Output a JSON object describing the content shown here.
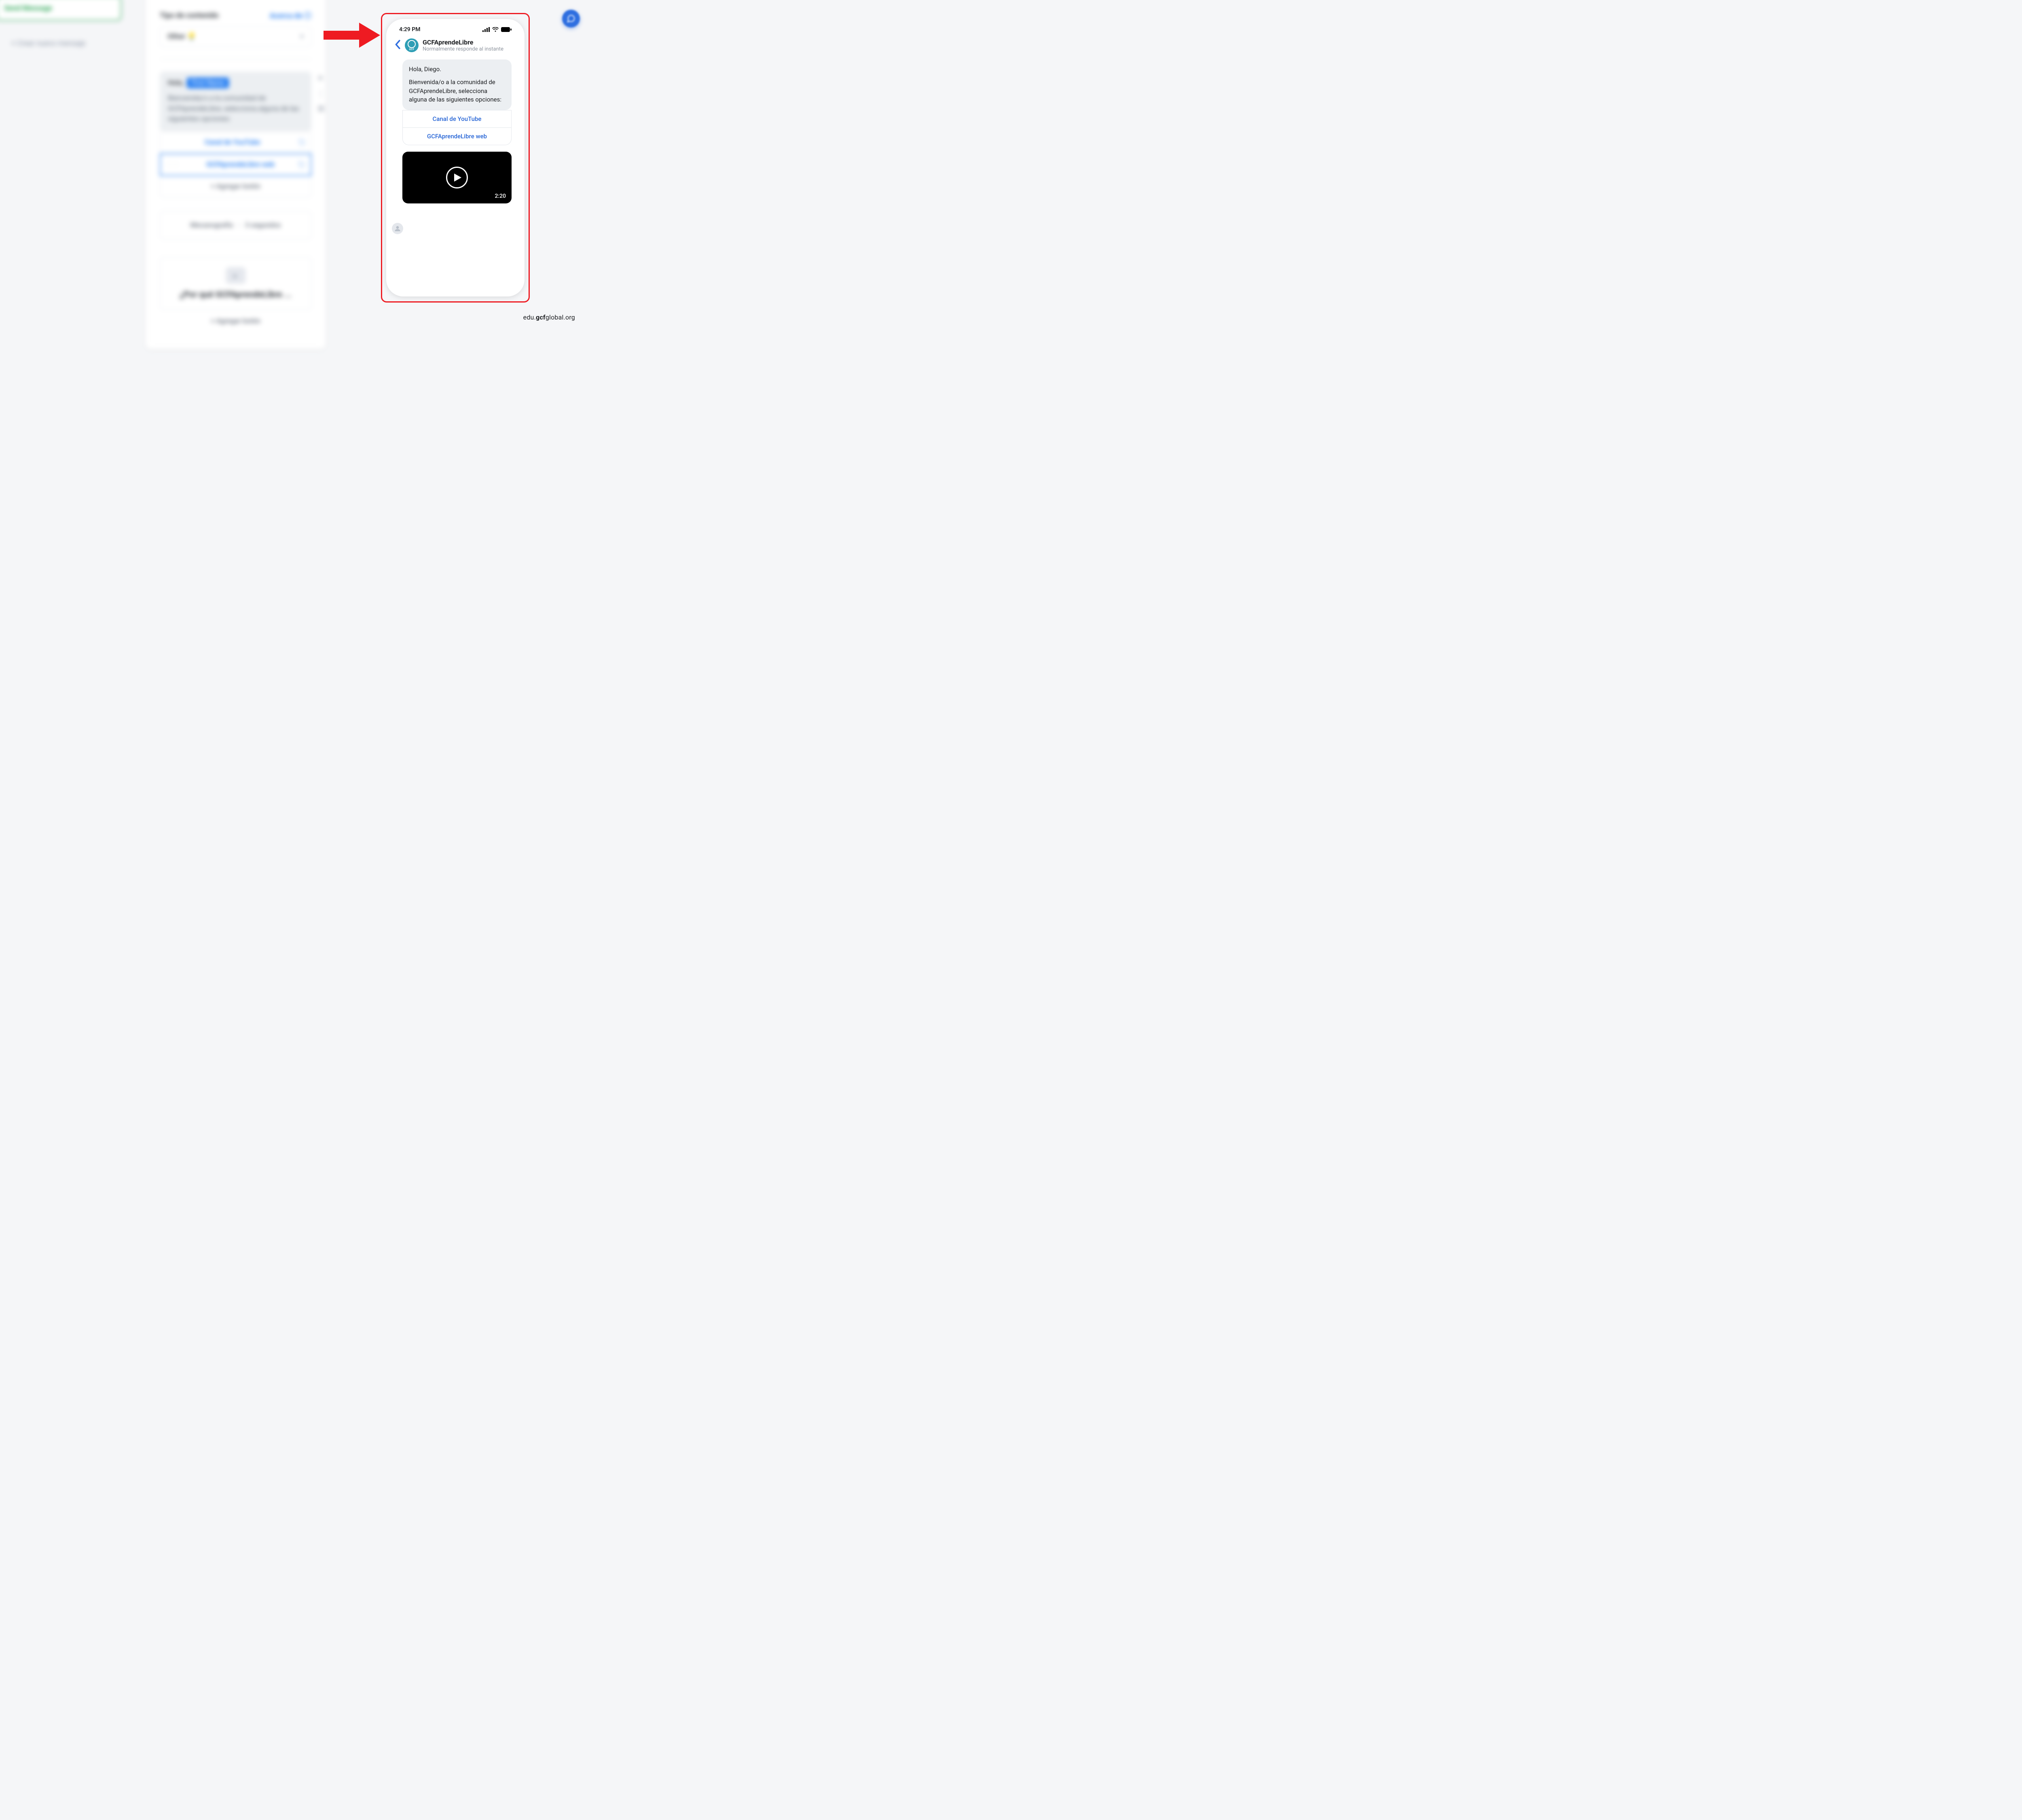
{
  "sidebar": {
    "send_message_label": "Send Message",
    "create_new_label": "+ Crear nuevo mensaje"
  },
  "editor": {
    "content_type_label": "Tipo de contenido",
    "about_link_label": "Acerca de ⓘ",
    "content_type_value": "Other",
    "message": {
      "greeting_prefix": "Hola,",
      "firstname_tag": "First Name",
      "body": "Bienvenida/o a la comunidad de GCFAprendeLibre, selecciona alguna de las siguientes opciones:",
      "option1": "Canal de YouTube",
      "option2": "GCFAprendeLibre web",
      "add_button_label": "+ Agregar botón"
    },
    "typing": {
      "label": "Mecanografía",
      "duration": "3 segundos"
    },
    "why_block": {
      "title": "¿Por qué GCFAprendeLibre ...",
      "add_button_label": "+ Agregar botón"
    }
  },
  "phone": {
    "time": "4:29 PM",
    "chat_name": "GCFAprendeLibre",
    "chat_subtitle": "Normalmente responde al instante",
    "avatar_label": "GCF",
    "message_line1": "Hola, Diego.",
    "message_line2": "Bienvenida/o a la comunidad de GCFAprendeLibre, selecciona alguna de las siguientes opciones:",
    "quick_reply_1": "Canal de YouTube",
    "quick_reply_2": "GCFAprendeLibre web",
    "video_duration": "2:20"
  },
  "watermark": {
    "prefix": "edu.",
    "bold": "gcf",
    "suffix": "global.org"
  }
}
